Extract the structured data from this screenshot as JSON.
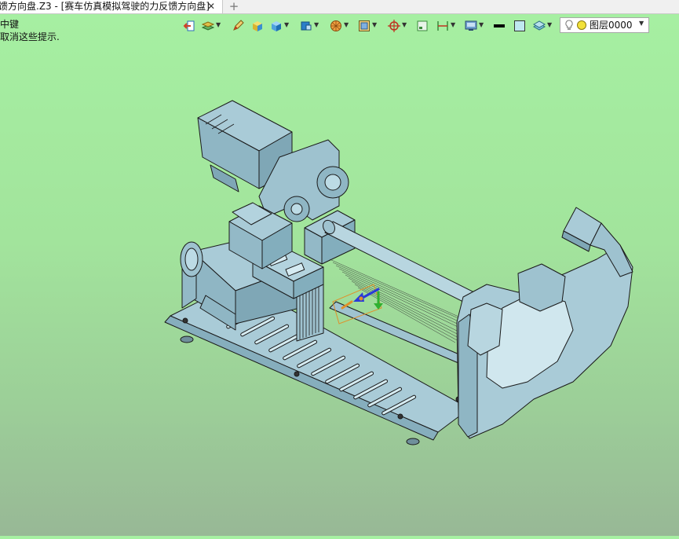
{
  "tab": {
    "title": "馈方向盘.Z3 - [赛车仿真模拟驾驶的力反馈方向盘]",
    "close": "✕",
    "add": "+"
  },
  "hint": {
    "line1": "中键",
    "line2": "取消这些提示."
  },
  "toolbar": {
    "icons": [
      "exit-icon",
      "layers-icon",
      "pen-icon",
      "box-icon",
      "cube-icon",
      "view-cube-icon",
      "sphere-icon",
      "frame-icon",
      "target-icon",
      "square-icon",
      "dimension-icon",
      "display-icon",
      "line-color-icon",
      "fill-color-icon",
      "plane-icon"
    ]
  },
  "layer": {
    "name": "图层0000"
  },
  "colors": {
    "bg_top": "#a6f0a2",
    "bg_bottom": "#98b896",
    "part": "#a9cbd7",
    "edge": "#1a1a1a"
  }
}
